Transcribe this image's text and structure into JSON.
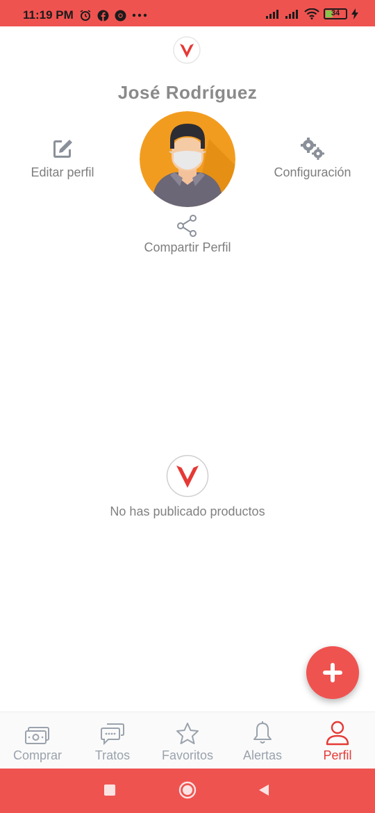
{
  "status_bar": {
    "time": "11:19 PM",
    "battery_level": "34",
    "icons": [
      "alarm-icon",
      "facebook-icon",
      "chrome-icon",
      "more-icon",
      "signal-icon",
      "signal-icon",
      "wifi-icon",
      "battery-icon",
      "charging-icon"
    ]
  },
  "profile": {
    "name": "José Rodríguez",
    "edit_label": "Editar perfil",
    "config_label": "Configuración",
    "share_label": "Compartir Perfil"
  },
  "empty_state": {
    "message": "No has publicado productos"
  },
  "fab": {
    "icon": "plus-icon"
  },
  "bottom_nav": {
    "items": [
      {
        "label": "Comprar",
        "icon": "money-icon",
        "active": false
      },
      {
        "label": "Tratos",
        "icon": "chat-icon",
        "active": false
      },
      {
        "label": "Favoritos",
        "icon": "star-icon",
        "active": false
      },
      {
        "label": "Alertas",
        "icon": "bell-icon",
        "active": false
      },
      {
        "label": "Perfil",
        "icon": "user-icon",
        "active": true
      }
    ]
  },
  "colors": {
    "accent": "#ef5350",
    "active_nav": "#e53935",
    "inactive_nav": "#9aa2ac",
    "text_gray": "#808080"
  }
}
